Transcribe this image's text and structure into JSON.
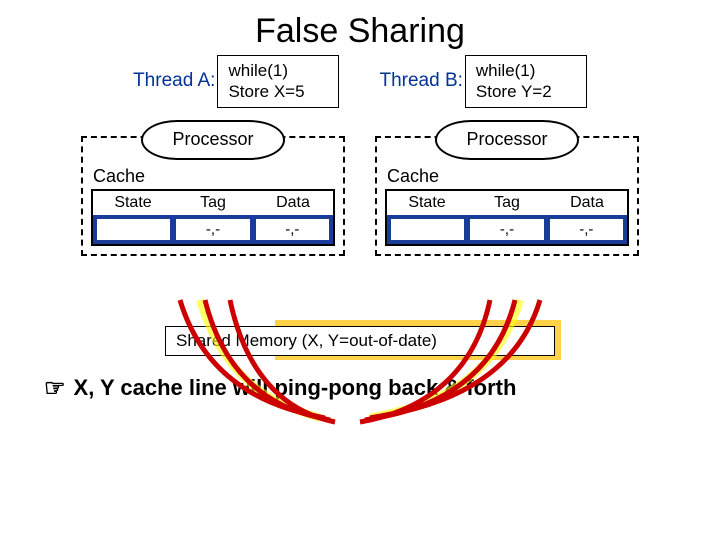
{
  "title": "False Sharing",
  "threadA": {
    "label": "Thread A:",
    "line1": "while(1)",
    "line2": "Store X=5"
  },
  "threadB": {
    "label": "Thread B:",
    "line1": "while(1)",
    "line2": "Store Y=2"
  },
  "processor_label": "Processor",
  "cache_label": "Cache",
  "headers": {
    "state": "State",
    "tag": "Tag",
    "data": "Data"
  },
  "cell_empty": "",
  "cell_dash": "-,-",
  "memory": "Shared Memory (X, Y=out-of-date)",
  "conclusion": "X, Y cache line will ping-pong back & forth",
  "hand": "☞"
}
